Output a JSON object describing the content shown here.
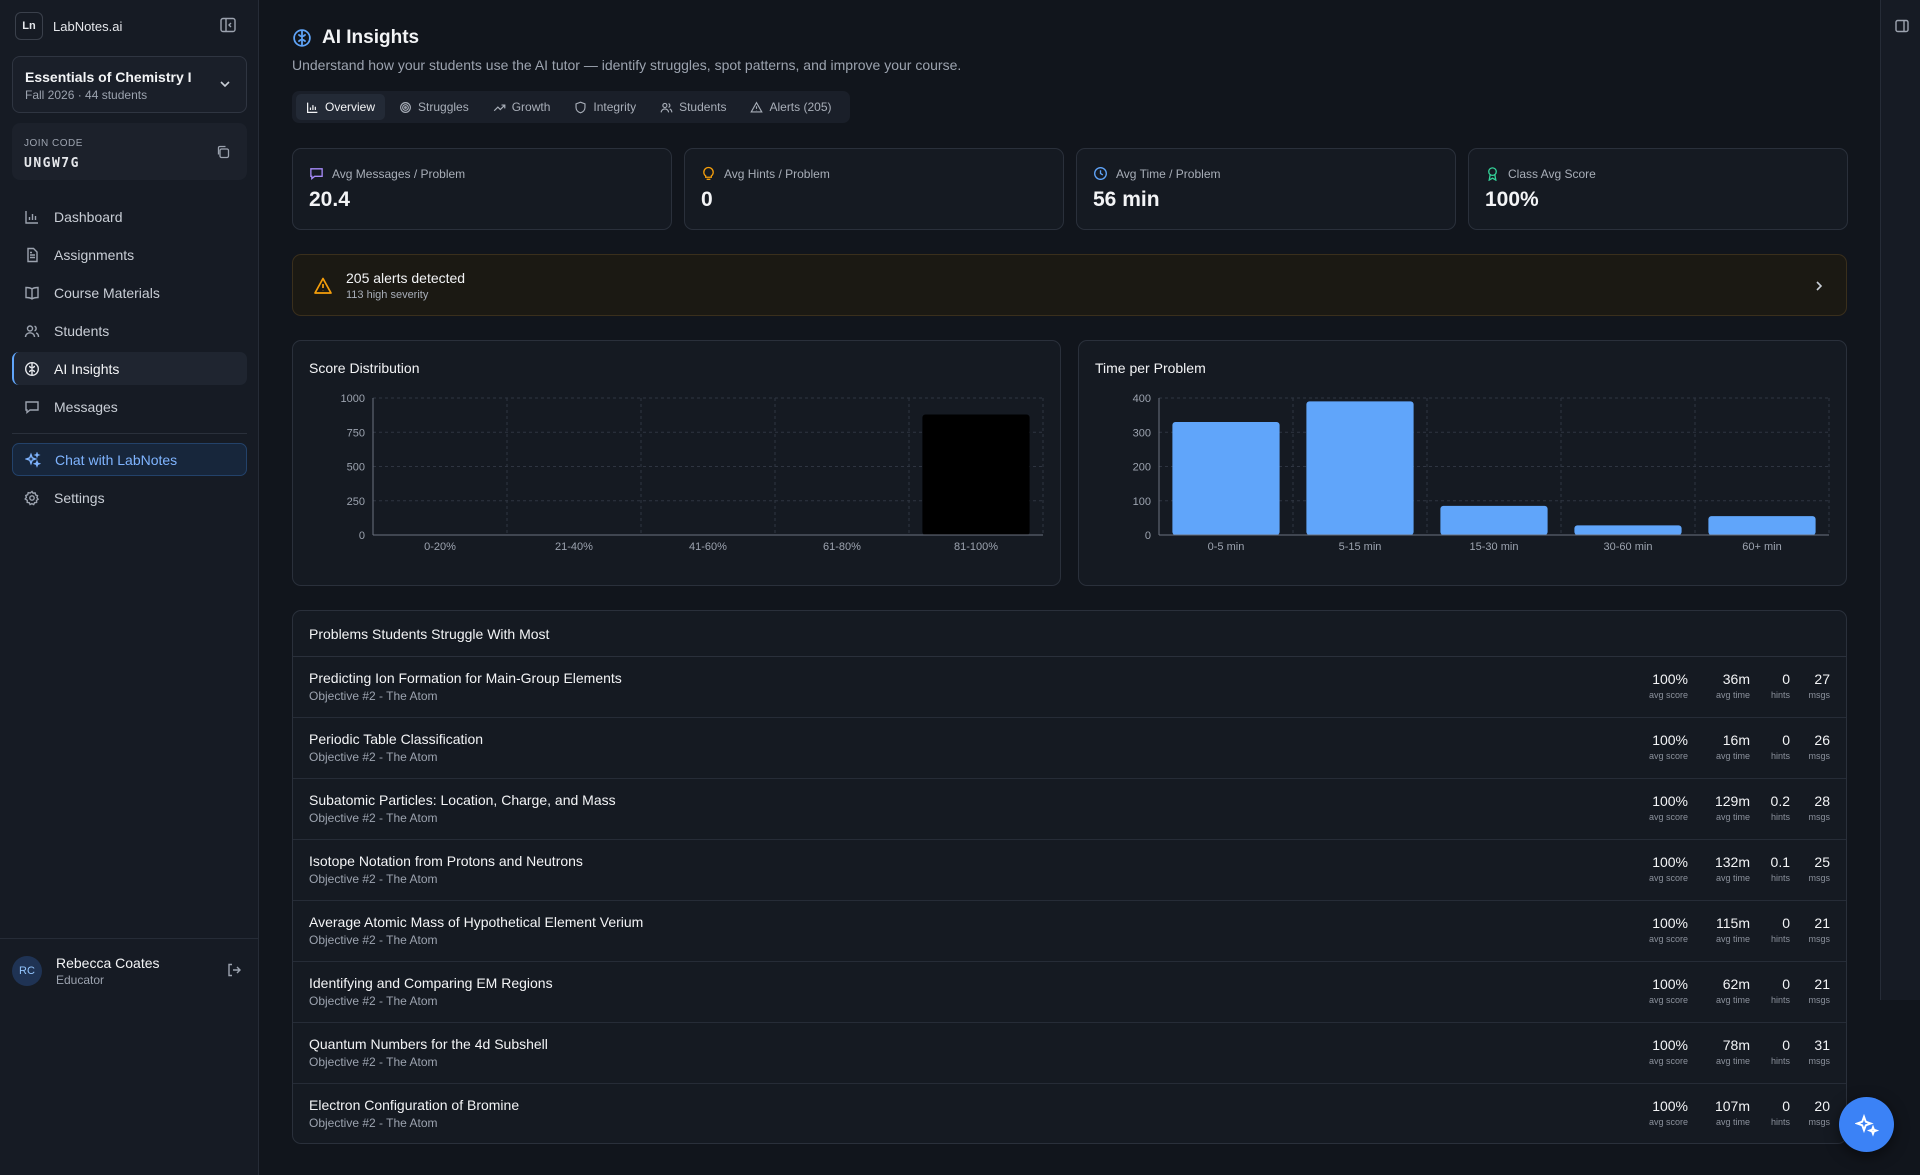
{
  "brand": {
    "logo": "Ln",
    "name": "LabNotes.ai"
  },
  "course": {
    "title": "Essentials of Chemistry I",
    "subtitle": "Fall 2026 · 44 students"
  },
  "join": {
    "label": "JOIN CODE",
    "code": "UNGW7G"
  },
  "nav": {
    "items": [
      {
        "label": "Dashboard",
        "icon": "bar-chart-icon"
      },
      {
        "label": "Assignments",
        "icon": "document-icon"
      },
      {
        "label": "Course Materials",
        "icon": "book-icon"
      },
      {
        "label": "Students",
        "icon": "users-icon"
      },
      {
        "label": "AI Insights",
        "icon": "brain-icon",
        "active": true
      },
      {
        "label": "Messages",
        "icon": "message-icon"
      }
    ],
    "chat": "Chat with LabNotes",
    "settings": "Settings"
  },
  "user": {
    "initials": "RC",
    "name": "Rebecca Coates",
    "role": "Educator"
  },
  "page": {
    "title": "AI Insights",
    "subtitle": "Understand how your students use the AI tutor — identify struggles, spot patterns, and improve your course."
  },
  "tabs": [
    {
      "label": "Overview",
      "icon": "bar-chart-icon",
      "active": true
    },
    {
      "label": "Struggles",
      "icon": "target-icon"
    },
    {
      "label": "Growth",
      "icon": "trending-up-icon"
    },
    {
      "label": "Integrity",
      "icon": "shield-icon"
    },
    {
      "label": "Students",
      "icon": "users-icon"
    },
    {
      "label": "Alerts (205)",
      "icon": "warning-icon"
    }
  ],
  "stats": [
    {
      "label": "Avg Messages / Problem",
      "value": "20.4",
      "icon": "message-icon",
      "color": "#a78bfa"
    },
    {
      "label": "Avg Hints / Problem",
      "value": "0",
      "icon": "lightbulb-icon",
      "color": "#f59e0b"
    },
    {
      "label": "Avg Time / Problem",
      "value": "56 min",
      "icon": "clock-icon",
      "color": "#60a5fa"
    },
    {
      "label": "Class Avg Score",
      "value": "100%",
      "icon": "award-icon",
      "color": "#34d399"
    }
  ],
  "alert": {
    "title": "205 alerts detected",
    "subtitle": "113 high severity",
    "color": "#f59e0b"
  },
  "chart_data": [
    {
      "type": "bar",
      "title": "Score Distribution",
      "categories": [
        "0-20%",
        "21-40%",
        "41-60%",
        "61-80%",
        "81-100%"
      ],
      "values": [
        0,
        0,
        0,
        0,
        880
      ],
      "yticks": [
        0,
        250,
        500,
        750,
        1000
      ],
      "ylim": [
        0,
        1000
      ],
      "bar_color": "#000000",
      "grid": true
    },
    {
      "type": "bar",
      "title": "Time per Problem",
      "categories": [
        "0-5 min",
        "5-15 min",
        "15-30 min",
        "30-60 min",
        "60+ min"
      ],
      "values": [
        330,
        390,
        85,
        28,
        55
      ],
      "yticks": [
        0,
        100,
        200,
        300,
        400
      ],
      "ylim": [
        0,
        400
      ],
      "bar_color": "#60a5fa",
      "grid": true
    }
  ],
  "struggles": {
    "title": "Problems Students Struggle With Most",
    "labels": {
      "score": "avg score",
      "time": "avg time",
      "hints": "hints",
      "msgs": "msgs"
    },
    "rows": [
      {
        "title": "Predicting Ion Formation for Main-Group Elements",
        "subtitle": "Objective #2 - The Atom",
        "score": "100%",
        "time": "36m",
        "hints": "0",
        "msgs": "27"
      },
      {
        "title": "Periodic Table Classification",
        "subtitle": "Objective #2 - The Atom",
        "score": "100%",
        "time": "16m",
        "hints": "0",
        "msgs": "26"
      },
      {
        "title": "Subatomic Particles: Location, Charge, and Mass",
        "subtitle": "Objective #2 - The Atom",
        "score": "100%",
        "time": "129m",
        "hints": "0.2",
        "msgs": "28"
      },
      {
        "title": "Isotope Notation from Protons and Neutrons",
        "subtitle": "Objective #2 - The Atom",
        "score": "100%",
        "time": "132m",
        "hints": "0.1",
        "msgs": "25"
      },
      {
        "title": "Average Atomic Mass of Hypothetical Element Verium",
        "subtitle": "Objective #2 - The Atom",
        "score": "100%",
        "time": "115m",
        "hints": "0",
        "msgs": "21"
      },
      {
        "title": "Identifying and Comparing EM Regions",
        "subtitle": "Objective #2 - The Atom",
        "score": "100%",
        "time": "62m",
        "hints": "0",
        "msgs": "21"
      },
      {
        "title": "Quantum Numbers for the 4d Subshell",
        "subtitle": "Objective #2 - The Atom",
        "score": "100%",
        "time": "78m",
        "hints": "0",
        "msgs": "31"
      },
      {
        "title": "Electron Configuration of Bromine",
        "subtitle": "Objective #2 - The Atom",
        "score": "100%",
        "time": "107m",
        "hints": "0",
        "msgs": "20"
      }
    ]
  },
  "colors": {
    "accent": "#3b82f6",
    "bar": "#60a5fa",
    "warning": "#f59e0b"
  }
}
